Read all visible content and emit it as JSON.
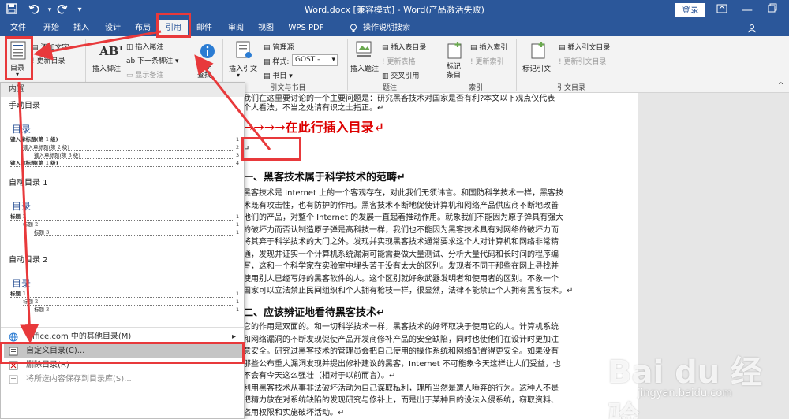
{
  "titlebar": {
    "title": "Word.docx [兼容模式] - Word(产品激活失败)",
    "login": "登录",
    "save_icon": "save-icon",
    "undo_icon": "undo-icon",
    "redo_icon": "redo-icon",
    "customize_icon": "customize-qat-icon"
  },
  "tabs": [
    "文件",
    "开始",
    "插入",
    "设计",
    "布局",
    "引用",
    "邮件",
    "审阅",
    "视图",
    "WPS PDF",
    "操作说明搜索"
  ],
  "active_tab": "引用",
  "ribbon": {
    "toc_label": "目录",
    "add_text": "添加文字",
    "update_toc": "更新目录",
    "insert_footnote": "插入脚注",
    "insert_endnote": "插入尾注",
    "next_footnote": "下一条脚注",
    "show_notes": "显示备注",
    "smart_lookup": "智能查找",
    "insert_citation": "插入引文",
    "manage_sources": "管理源",
    "style_label": "样式:",
    "style_value": "GOST - ",
    "bibliography": "书目",
    "insert_caption": "插入题注",
    "insert_table_of_figures": "插入表目录",
    "update_table": "更新表格",
    "cross_reference": "交叉引用",
    "mark_entry": "标记条目",
    "insert_index": "插入索引",
    "update_index": "更新索引",
    "mark_citation": "标记引文",
    "insert_toa": "插入引文目录",
    "update_toa": "更新引文目录",
    "groups": [
      "引文与书目",
      "题注",
      "索引",
      "引文目录"
    ]
  },
  "dropdown": {
    "header": "内置",
    "manual_toc": "手动目录",
    "toc_heading": "目录",
    "manual_lines": [
      {
        "text": "键入章标题(第 1 级)",
        "num": "1"
      },
      {
        "text": "键入章标题(第 2 级)",
        "num": "2"
      },
      {
        "text": "键入章标题(第 3 级)",
        "num": "3"
      },
      {
        "text": "键入章标题(第 1 级)",
        "num": "4"
      }
    ],
    "auto_toc_1": "自动目录 1",
    "auto_toc_2": "自动目录 2",
    "auto_lines": [
      {
        "text": "标题 1",
        "num": "1"
      },
      {
        "text": "标题 2",
        "num": "1"
      },
      {
        "text": "标题 3",
        "num": "1"
      }
    ],
    "office_more": "Office.com 中的其他目录(M)",
    "custom_toc": "自定义目录(C)...",
    "delete_toc": "删除目录(R)",
    "save_selection": "将所选内容保存到目录库(S)..."
  },
  "document": {
    "line_top1": "我们在这里要讨论的一个主要问题是：研究黑客技术对国家是否有利?本文以下观点仅代表",
    "line_top2": "个人看法，不当之处请有识之士指正。↵",
    "red_title": "→→→→在此行插入目录↵",
    "empty_para": "↵",
    "h1": "一、黑客技术属于科学技术的范畴↵",
    "para1": [
      "黑客技术是 Internet 上的一个客观存在，对此我们无须讳言。和国防科学技术一样，黑客技",
      "术既有攻击性，也有防护的作用。黑客技术不断地促使计算机和网络产品供应商不断地改善",
      "他们的产品，对整个 Internet 的发展一直起着推动作用。就象我们不能因为原子弹具有强大",
      "的破坏力而否认制造原子弹是高科技一样，我们也不能因为黑客技术具有对网络的破坏力而",
      "将其弃于科学技术的大门之外。发现并实现黑客技术通常要求这个人对计算机和网络非常精",
      "通，发现并证实一个计算机系统漏洞可能需要做大量测试、分析大量代码和长时间的程序编",
      "写，这和一个科学家在实验室中埋头苦干没有太大的区别。发现者不同于那些在网上寻找并",
      "使用别人已经写好的黑客软件的人。这个区别就好象武器发明者和使用者的区别。不象一个",
      "国家可以立法禁止民间组织和个人拥有枪枝一样，很显然，法律不能禁止个人拥有黑客技术。↵"
    ],
    "h2": "二、应该辨证地看待黑客技术↵",
    "para2": [
      "它的作用是双面的。和一切科学技术一样，黑客技术的好坏取决于使用它的人。计算机系统",
      "和网络漏洞的不断发现促使产品开发商修补产品的安全缺陷，同时也使他们在设计时更加注",
      "意安全。研究过黑客技术的管理员会把自己使用的操作系统和网络配置得更安全。如果没有",
      "那些公布重大漏洞发现并提出修补建议的黑客，Internet 不可能象今天这样让人们受益，也",
      "不会有今天这么强壮（相对于以前而言）。↵",
      "利用黑客技术从事非法破坏活动为自己谋取私利，理所当然是遭人唾弃的行为。这种人不是",
      "把精力放在对系统缺陷的发现研究与修补上，而是出于某种目的设法入侵系统，窃取资料、",
      "盗用权限和实施破坏活动。↵"
    ]
  },
  "watermark": {
    "brand": "Bai du 经验",
    "url": "jingyan.baidu.com"
  },
  "colors": {
    "word_blue": "#2b579a",
    "annotation_red": "#e8393b"
  }
}
